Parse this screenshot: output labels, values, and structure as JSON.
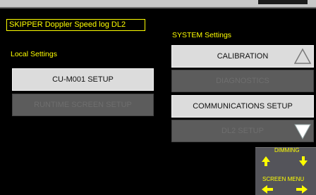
{
  "header": {
    "title": "SKIPPER Doppler Speed log DL2"
  },
  "local_settings": {
    "heading": "Local Settings",
    "buttons": [
      "CU-M001 SETUP",
      "RUNTIME SCREEN SETUP"
    ]
  },
  "system_settings": {
    "heading": "SYSTEM Settings",
    "buttons": [
      "CALIBRATION",
      "DIAGNOSTICS",
      "COMMUNICATIONS SETUP",
      "DL2 SETUP"
    ]
  },
  "dimming": {
    "label": "DIMMING",
    "screen_menu_label": "SCREEN MENU"
  },
  "colors": {
    "accent": "#ffff00",
    "background": "#000000",
    "button_light": "#dcdcdc",
    "button_dark": "#5c5c5c"
  }
}
